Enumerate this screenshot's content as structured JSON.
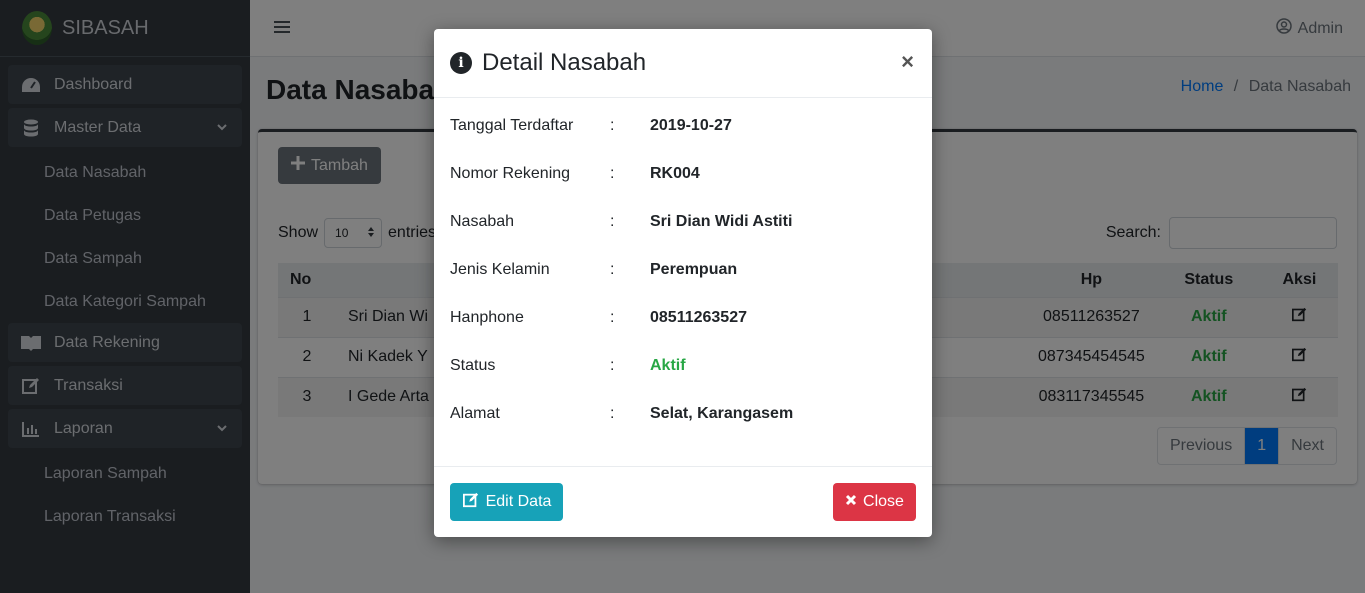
{
  "brand": {
    "name": "SIBASAH",
    "logo_icon": "emblem-logo"
  },
  "sidebar": {
    "items": [
      {
        "label": "Dashboard",
        "icon": "tachometer-icon"
      },
      {
        "label": "Master Data",
        "icon": "database-icon",
        "expanded": true
      },
      {
        "label": "Data Nasabah"
      },
      {
        "label": "Data Petugas"
      },
      {
        "label": "Data Sampah"
      },
      {
        "label": "Data Kategori Sampah"
      },
      {
        "label": "Data Rekening",
        "icon": "book-icon"
      },
      {
        "label": "Transaksi",
        "icon": "edit-icon"
      },
      {
        "label": "Laporan",
        "icon": "chart-icon",
        "expanded": true
      },
      {
        "label": "Laporan Sampah"
      },
      {
        "label": "Laporan Transaksi"
      }
    ]
  },
  "topbar": {
    "user": "Admin"
  },
  "page": {
    "title": "Data Nasabah",
    "breadcrumb": {
      "home": "Home",
      "separator": "/",
      "current": "Data Nasabah"
    }
  },
  "card": {
    "add_button": "Tambah",
    "show_label": "Show",
    "show_value": "10",
    "entries_label": "entries",
    "search_label": "Search:",
    "table": {
      "headers": [
        "No",
        "Hp",
        "Status",
        "Aksi"
      ],
      "rows": [
        {
          "no": "1",
          "name": "Sri Dian Wi",
          "hp": "08511263527",
          "status": "Aktif"
        },
        {
          "no": "2",
          "name": "Ni Kadek Y",
          "hp": "087345454545",
          "status": "Aktif"
        },
        {
          "no": "3",
          "name": "I Gede Arta",
          "hp": "083117345545",
          "status": "Aktif"
        }
      ]
    },
    "pagination": {
      "previous": "Previous",
      "page": "1",
      "next": "Next"
    }
  },
  "modal": {
    "title": "Detail Nasabah",
    "close_symbol": "×",
    "colon": ":",
    "fields": [
      {
        "label": "Tanggal Terdaftar",
        "value": "2019-10-27"
      },
      {
        "label": "Nomor Rekening",
        "value": "RK004"
      },
      {
        "label": "Nasabah",
        "value": "Sri Dian Widi Astiti"
      },
      {
        "label": "Jenis Kelamin",
        "value": "Perempuan"
      },
      {
        "label": "Hanphone",
        "value": "08511263527"
      },
      {
        "label": "Status",
        "value": "Aktif"
      },
      {
        "label": "Alamat",
        "value": "Selat, Karangasem"
      }
    ],
    "edit_button": "Edit Data",
    "close_button": "Close"
  },
  "colors": {
    "accent": "#007bff",
    "success": "#28a745",
    "danger": "#dc3545",
    "info": "#17a2b8",
    "sidebar": "#343a40"
  }
}
